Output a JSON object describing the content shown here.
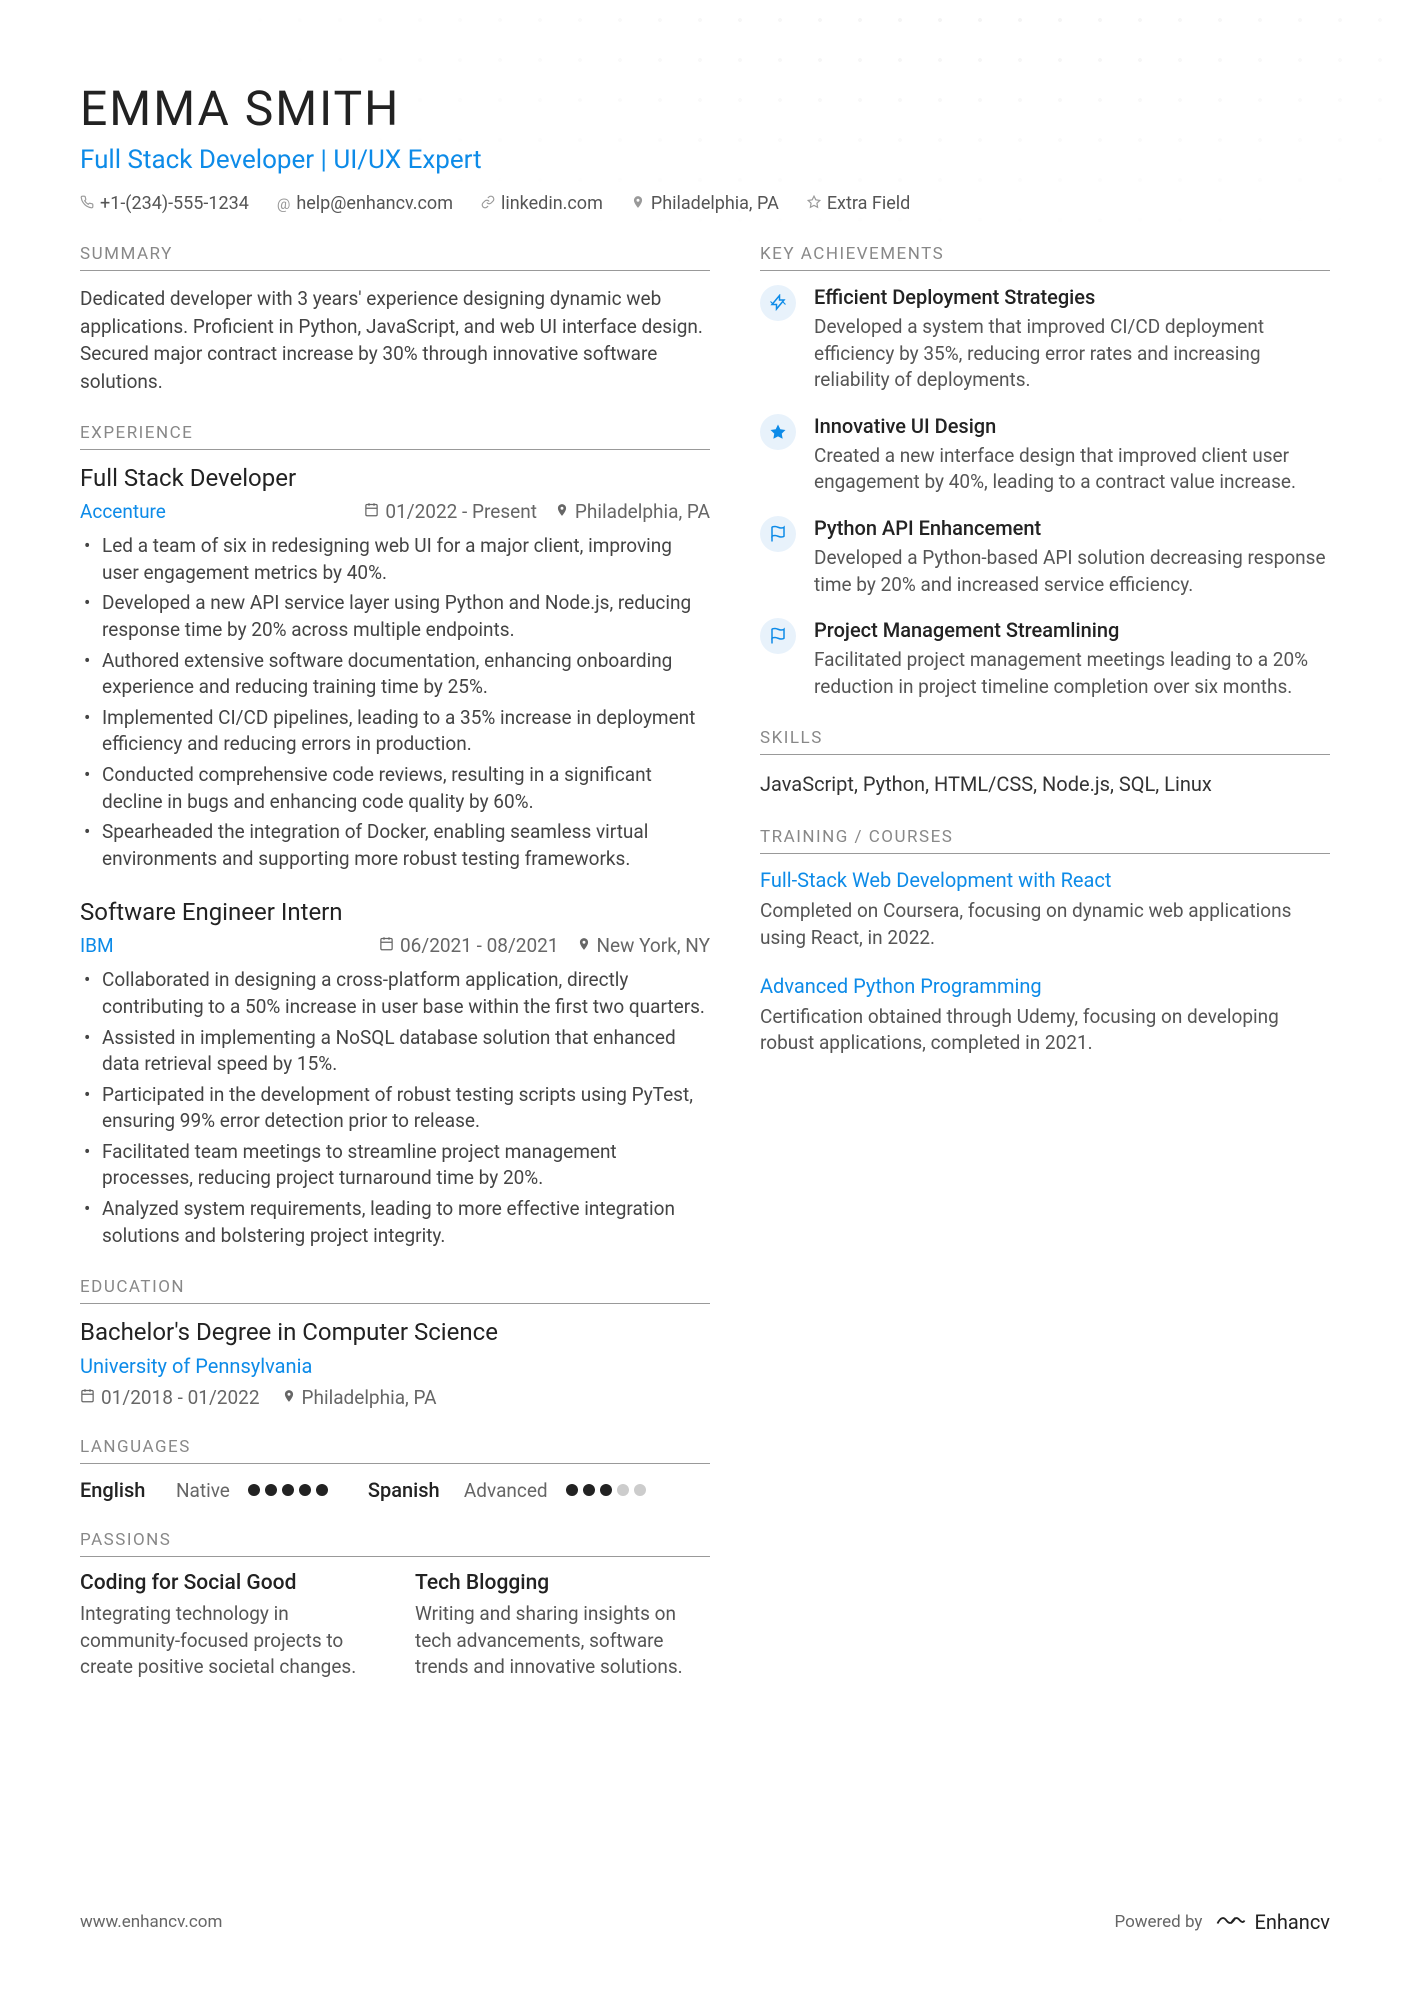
{
  "header": {
    "name": "EMMA SMITH",
    "title": "Full Stack Developer | UI/UX Expert",
    "phone": "+1-(234)-555-1234",
    "email": "help@enhancv.com",
    "link": "linkedin.com",
    "location": "Philadelphia, PA",
    "extra": "Extra Field"
  },
  "section_titles": {
    "summary": "SUMMARY",
    "experience": "EXPERIENCE",
    "education": "EDUCATION",
    "languages": "LANGUAGES",
    "passions": "PASSIONS",
    "achievements": "KEY ACHIEVEMENTS",
    "skills": "SKILLS",
    "training": "TRAINING / COURSES"
  },
  "summary": "Dedicated developer with 3 years' experience designing dynamic web applications. Proficient in Python, JavaScript, and web UI interface design. Secured major contract increase by 30% through innovative software solutions.",
  "experience": [
    {
      "title": "Full Stack Developer",
      "company": "Accenture",
      "dates": "01/2022 - Present",
      "location": "Philadelphia, PA",
      "bullets": [
        "Led a team of six in redesigning web UI for a major client, improving user engagement metrics by 40%.",
        "Developed a new API service layer using Python and Node.js, reducing response time by 20% across multiple endpoints.",
        "Authored extensive software documentation, enhancing onboarding experience and reducing training time by 25%.",
        "Implemented CI/CD pipelines, leading to a 35% increase in deployment efficiency and reducing errors in production.",
        "Conducted comprehensive code reviews, resulting in a significant decline in bugs and enhancing code quality by 60%.",
        "Spearheaded the integration of Docker, enabling seamless virtual environments and supporting more robust testing frameworks."
      ]
    },
    {
      "title": "Software Engineer Intern",
      "company": "IBM",
      "dates": "06/2021 - 08/2021",
      "location": "New York, NY",
      "bullets": [
        "Collaborated in designing a cross-platform application, directly contributing to a 50% increase in user base within the first two quarters.",
        "Assisted in implementing a NoSQL database solution that enhanced data retrieval speed by 15%.",
        "Participated in the development of robust testing scripts using PyTest, ensuring 99% error detection prior to release.",
        "Facilitated team meetings to streamline project management processes, reducing project turnaround time by 20%.",
        "Analyzed system requirements, leading to more effective integration solutions and bolstering project integrity."
      ]
    }
  ],
  "education": {
    "degree": "Bachelor's Degree in Computer Science",
    "school": "University of Pennsylvania",
    "dates": "01/2018 - 01/2022",
    "location": "Philadelphia, PA"
  },
  "languages": [
    {
      "name": "English",
      "level": "Native",
      "rating": 5
    },
    {
      "name": "Spanish",
      "level": "Advanced",
      "rating": 3
    }
  ],
  "passions": [
    {
      "title": "Coding for Social Good",
      "desc": "Integrating technology in community-focused projects to create positive societal changes."
    },
    {
      "title": "Tech Blogging",
      "desc": "Writing and sharing insights on tech advancements, software trends and innovative solutions."
    }
  ],
  "achievements": [
    {
      "icon": "bolt",
      "title": "Efficient Deployment Strategies",
      "desc": "Developed a system that improved CI/CD deployment efficiency by 35%, reducing error rates and increasing reliability of deployments."
    },
    {
      "icon": "star",
      "title": "Innovative UI Design",
      "desc": "Created a new interface design that improved client user engagement by 40%, leading to a contract value increase."
    },
    {
      "icon": "flag",
      "title": "Python API Enhancement",
      "desc": "Developed a Python-based API solution decreasing response time by 20% and increased service efficiency."
    },
    {
      "icon": "flag",
      "title": "Project Management Streamlining",
      "desc": "Facilitated project management meetings leading to a 20% reduction in project timeline completion over six months."
    }
  ],
  "skills": "JavaScript, Python, HTML/CSS, Node.js, SQL, Linux",
  "courses": [
    {
      "title": "Full-Stack Web Development with React",
      "desc": "Completed on Coursera, focusing on dynamic web applications using React, in 2022."
    },
    {
      "title": "Advanced Python Programming",
      "desc": "Certification obtained through Udemy, focusing on developing robust applications, completed in 2021."
    }
  ],
  "footer": {
    "url": "www.enhancv.com",
    "powered": "Powered by",
    "brand": "Enhancv"
  }
}
